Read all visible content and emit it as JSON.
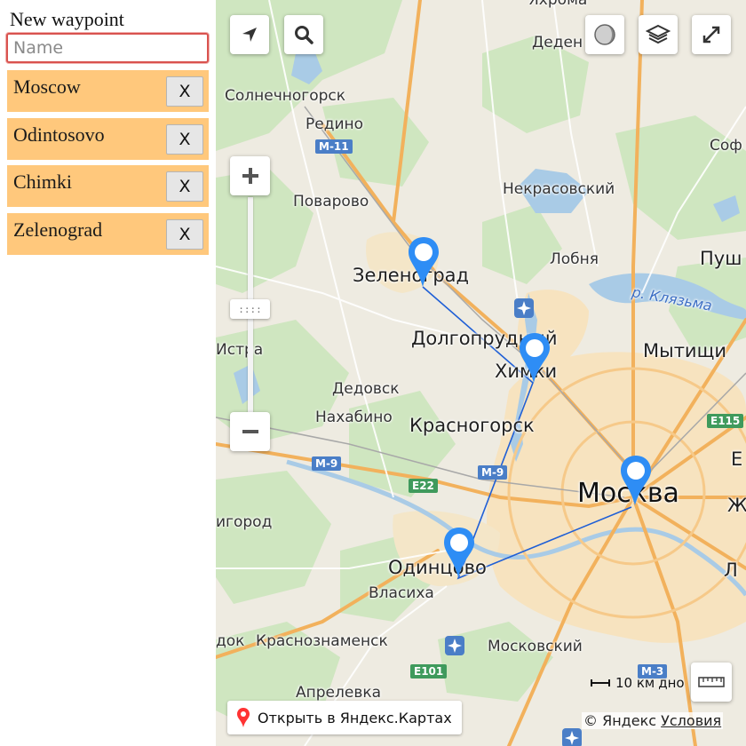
{
  "panel": {
    "title": "New waypoint",
    "name_input": {
      "value": "",
      "placeholder": "Name"
    },
    "waypoints": [
      {
        "label": "Moscow",
        "delete_label": "X"
      },
      {
        "label": "Odintosovo",
        "delete_label": "X"
      },
      {
        "label": "Chimki",
        "delete_label": "X"
      },
      {
        "label": "Zelenograd",
        "delete_label": "X"
      }
    ]
  },
  "map": {
    "labels": {
      "yahroma": "Яхрома",
      "dedenevo": "Деден",
      "solnechnogorsk": "Солнечногорск",
      "redino": "Редино",
      "sofrino": "Соф",
      "povarovo": "Поварово",
      "nekrasovsky": "Некрасовский",
      "zelenograd": "Зеленоград",
      "lobnya": "Лобня",
      "pushkino": "Пуш",
      "klyazma_river": "р. Клязьма",
      "dolgoprudny": "Долгопрудный",
      "mytishchi": "Мытищи",
      "istra": "Истра",
      "khimki": "Химки",
      "dedovsk": "Дедовск",
      "nakhabino": "Нахабино",
      "krasnogorsk": "Красногорск",
      "moskva": "Москва",
      "zhukovsky": "Ж",
      "zvenigorod": "игород",
      "odintsovo": "Одинцово",
      "vlasikha": "Власиха",
      "lytkarino": "Лі",
      "krasnoznamensk": "Краснознаменск",
      "moskovsky": "Московский",
      "dok": "док",
      "aprelevka": "Апрелевка",
      "e": "Е",
      "l": "Л"
    },
    "shields": {
      "m11": "М-11",
      "m9a": "М-9",
      "m9b": "М-9",
      "e22": "E22",
      "e115": "E115",
      "e101": "E101",
      "m3": "М-3"
    },
    "scale_label": "10 км",
    "scale_suffix": "дно",
    "open_link": "Открыть в Яндекс.Картах",
    "copyright": "© Яндекс",
    "terms": "Условия",
    "zoom_handle": "::::",
    "route_color": "#1f5fd6",
    "pin_color": "#2e8df5",
    "panel_item_color": "#ffc87c"
  }
}
